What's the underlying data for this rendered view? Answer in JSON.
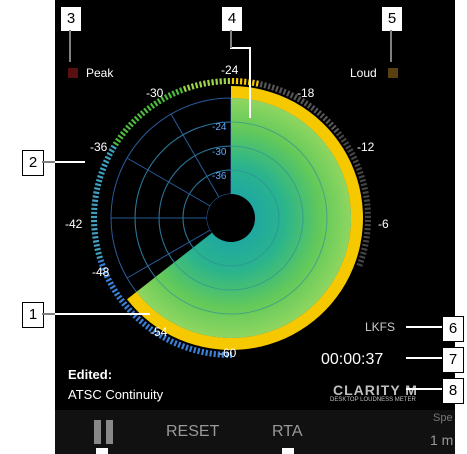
{
  "meter": {
    "peak_label": "Peak",
    "loud_label": "Loud",
    "unit": "LKFS",
    "time": "00:00:37",
    "edited_label": "Edited:",
    "preset": "ATSC Continuity",
    "scale_outer": [
      "-60",
      "-54",
      "-48",
      "-42",
      "-36",
      "-30",
      "-24",
      "-18",
      "-12",
      "-6"
    ],
    "scale_inner": [
      "-24",
      "-30",
      "-36"
    ]
  },
  "brand": {
    "name": "CLARITY M",
    "tagline": "DESKTOP LOUDNESS METER"
  },
  "controls": {
    "reset": "RESET",
    "rta": "RTA",
    "speed_label": "Spe",
    "speed_value": "1 m"
  },
  "callouts": [
    "1",
    "2",
    "3",
    "4",
    "5",
    "6",
    "7",
    "8"
  ],
  "colors": {
    "background": "#000000",
    "yellow": "#f5c800",
    "blue": "#3a7fd6",
    "green": "#4cbb3c",
    "teal": "#1aa6a6"
  }
}
